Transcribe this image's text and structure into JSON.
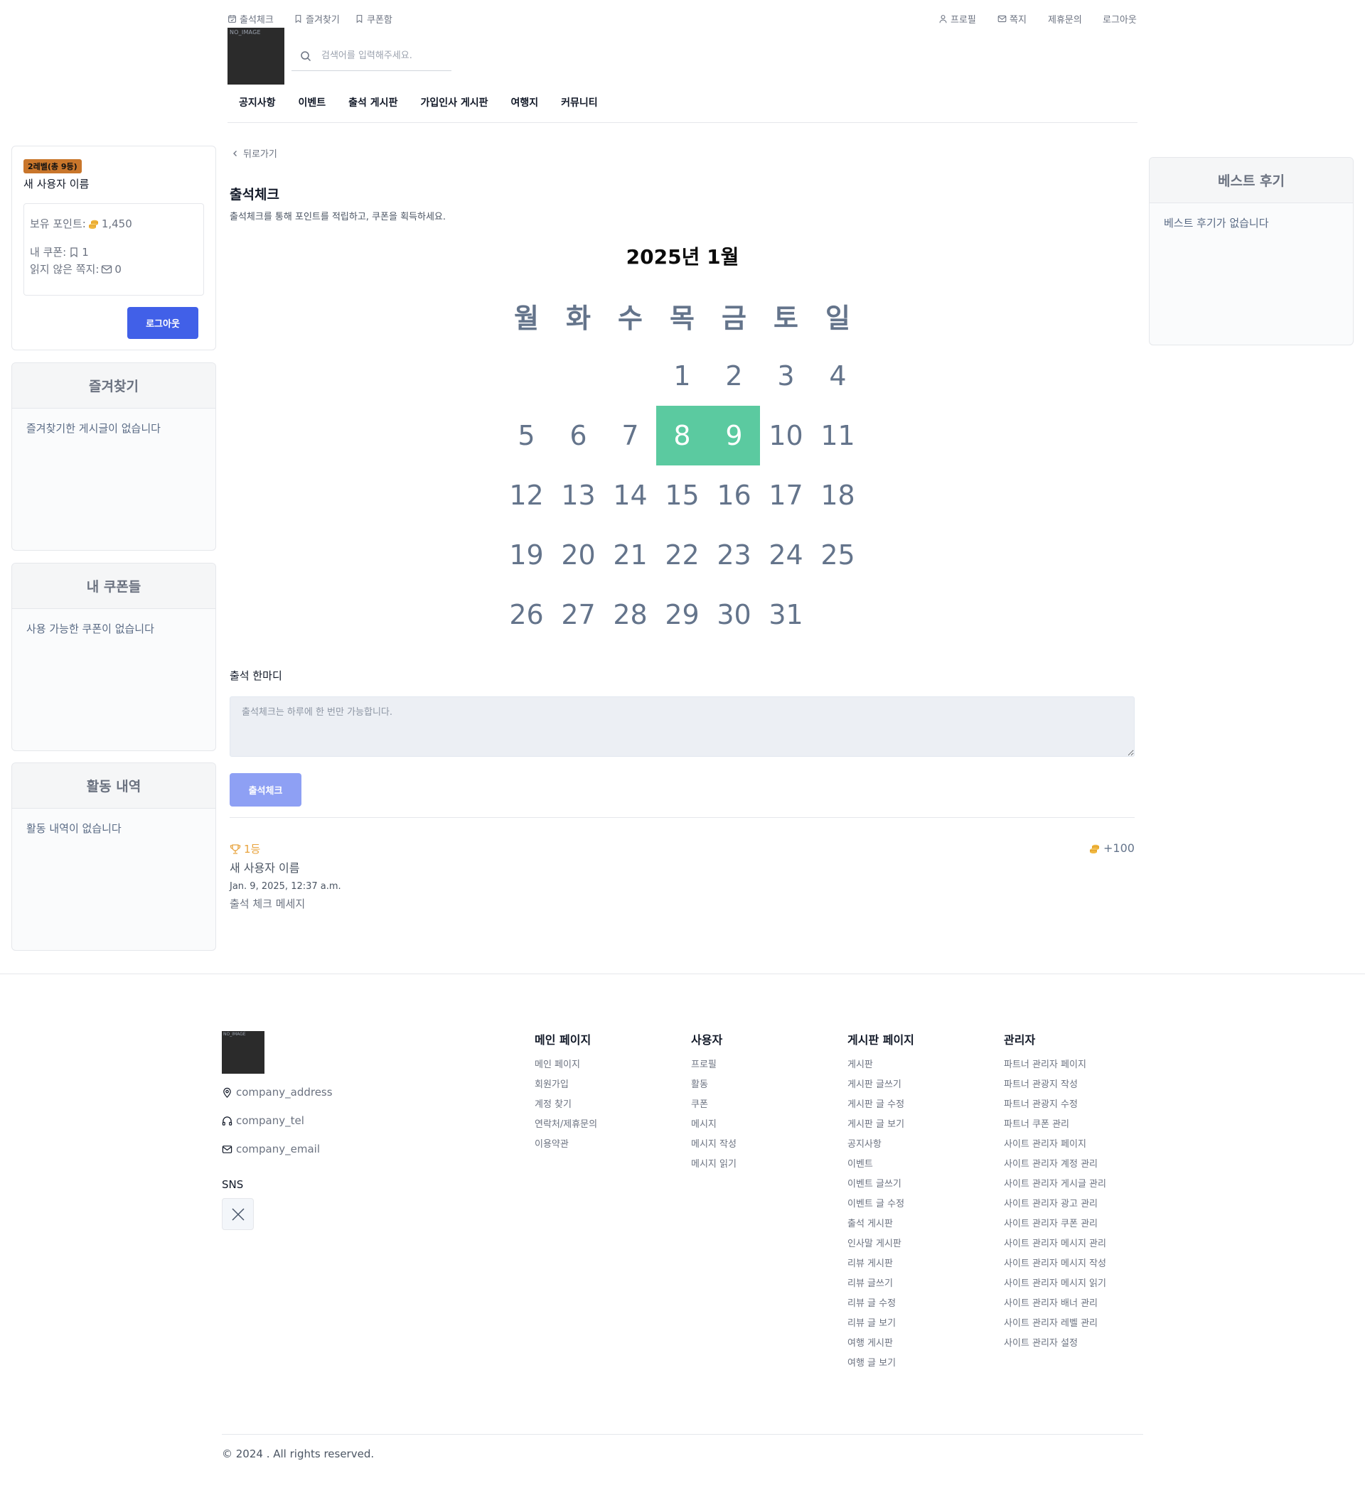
{
  "header": {
    "top_left": [
      {
        "label": "출석체크",
        "icon": "calendar-check-icon"
      },
      {
        "label": "즐겨찾기",
        "icon": "bookmark-icon"
      },
      {
        "label": "쿠폰함",
        "icon": "bookmark-icon"
      }
    ],
    "top_right": [
      {
        "label": "프로필",
        "icon": "user-icon"
      },
      {
        "label": "쪽지",
        "icon": "envelope-icon"
      },
      {
        "label": "제휴문의"
      },
      {
        "label": "로그아웃"
      }
    ],
    "logo_text": "NO_IMAGE",
    "search_placeholder": "검색어를 입력해주세요.",
    "nav": [
      "공지사항",
      "이벤트",
      "출석 게시판",
      "가입인사 게시판",
      "여행지",
      "커뮤니티"
    ]
  },
  "sidebar_left": {
    "profile": {
      "level_badge": "2레벨(총 9등)",
      "name": "새 사용자 이름",
      "points_label": "보유 포인트:",
      "points_value": "1,450",
      "coupons_label": "내 쿠폰:",
      "coupons_value": "1",
      "unread_label": "읽지 않은 쪽지:",
      "unread_value": "0",
      "logout_label": "로그아웃"
    },
    "favorites": {
      "title": "즐겨찾기",
      "empty": "즐겨찾기한 게시글이 없습니다"
    },
    "coupons": {
      "title": "내 쿠폰들",
      "empty": "사용 가능한 쿠폰이 없습니다"
    },
    "activity": {
      "title": "활동 내역",
      "empty": "활동 내역이 없습니다"
    }
  },
  "sidebar_right": {
    "best_reviews": {
      "title": "베스트 후기",
      "empty": "베스트 후기가 없습니다"
    }
  },
  "main": {
    "back_label": "뒤로가기",
    "title": "출석체크",
    "subtitle": "출석체크를 통해 포인트를 적립하고, 쿠폰을 획득하세요.",
    "calendar": {
      "title": "2025년 1월",
      "weekdays": [
        "월",
        "화",
        "수",
        "목",
        "금",
        "토",
        "일"
      ],
      "weeks": [
        [
          "",
          "",
          "",
          "1",
          "2",
          "3",
          "4"
        ],
        [
          "5",
          "6",
          "7",
          "8",
          "9",
          "10",
          "11"
        ],
        [
          "12",
          "13",
          "14",
          "15",
          "16",
          "17",
          "18"
        ],
        [
          "19",
          "20",
          "21",
          "22",
          "23",
          "24",
          "25"
        ],
        [
          "26",
          "27",
          "28",
          "29",
          "30",
          "31",
          ""
        ]
      ],
      "checked_days": [
        "8",
        "9"
      ],
      "checked_color": "#5bcaa0"
    },
    "comment_label": "출석 한마디",
    "comment_placeholder": "출석체크는 하루에 한 번만 가능합니다.",
    "check_button": "출석체크",
    "entries": [
      {
        "rank": "1등",
        "name": "새 사용자 이름",
        "time": "Jan. 9, 2025, 12:37 a.m.",
        "message": "출석 체크 메세지",
        "points": "+100"
      }
    ]
  },
  "footer": {
    "logo_text": "NO_IMAGE",
    "address": "company_address",
    "tel": "company_tel",
    "email": "company_email",
    "sns_label": "SNS",
    "columns": [
      {
        "title": "메인 페이지",
        "items": [
          "메인 페이지",
          "회원가입",
          "계정 찾기",
          "연락처/제휴문의",
          "이용약관"
        ]
      },
      {
        "title": "사용자",
        "items": [
          "프로필",
          "활동",
          "쿠폰",
          "메시지",
          "메시지 작성",
          "메시지 읽기"
        ]
      },
      {
        "title": "게시판 페이지",
        "items": [
          "게시판",
          "게시판 글쓰기",
          "게시판 글 수정",
          "게시판 글 보기",
          "공지사항",
          "이벤트",
          "이벤트 글쓰기",
          "이벤트 글 수정",
          "출석 게시판",
          "인사말 게시판",
          "리뷰 게시판",
          "리뷰 글쓰기",
          "리뷰 글 수정",
          "리뷰 글 보기",
          "여행 게시판",
          "여행 글 보기"
        ]
      },
      {
        "title": "관리자",
        "items": [
          "파트너 관리자 페이지",
          "파트너 관광지 작성",
          "파트너 관광지 수정",
          "파트너 쿠폰 관리",
          "사이트 관리자 페이지",
          "사이트 관리자 계정 관리",
          "사이트 관리자 게시글 관리",
          "사이트 관리자 광고 관리",
          "사이트 관리자 쿠폰 관리",
          "사이트 관리자 메시지 관리",
          "사이트 관리자 메시지 작성",
          "사이트 관리자 메시지 읽기",
          "사이트 관리자 배너 관리",
          "사이트 관리자 레벨 관리",
          "사이트 관리자 설정"
        ]
      }
    ],
    "copyright": "© 2024 . All rights reserved."
  }
}
